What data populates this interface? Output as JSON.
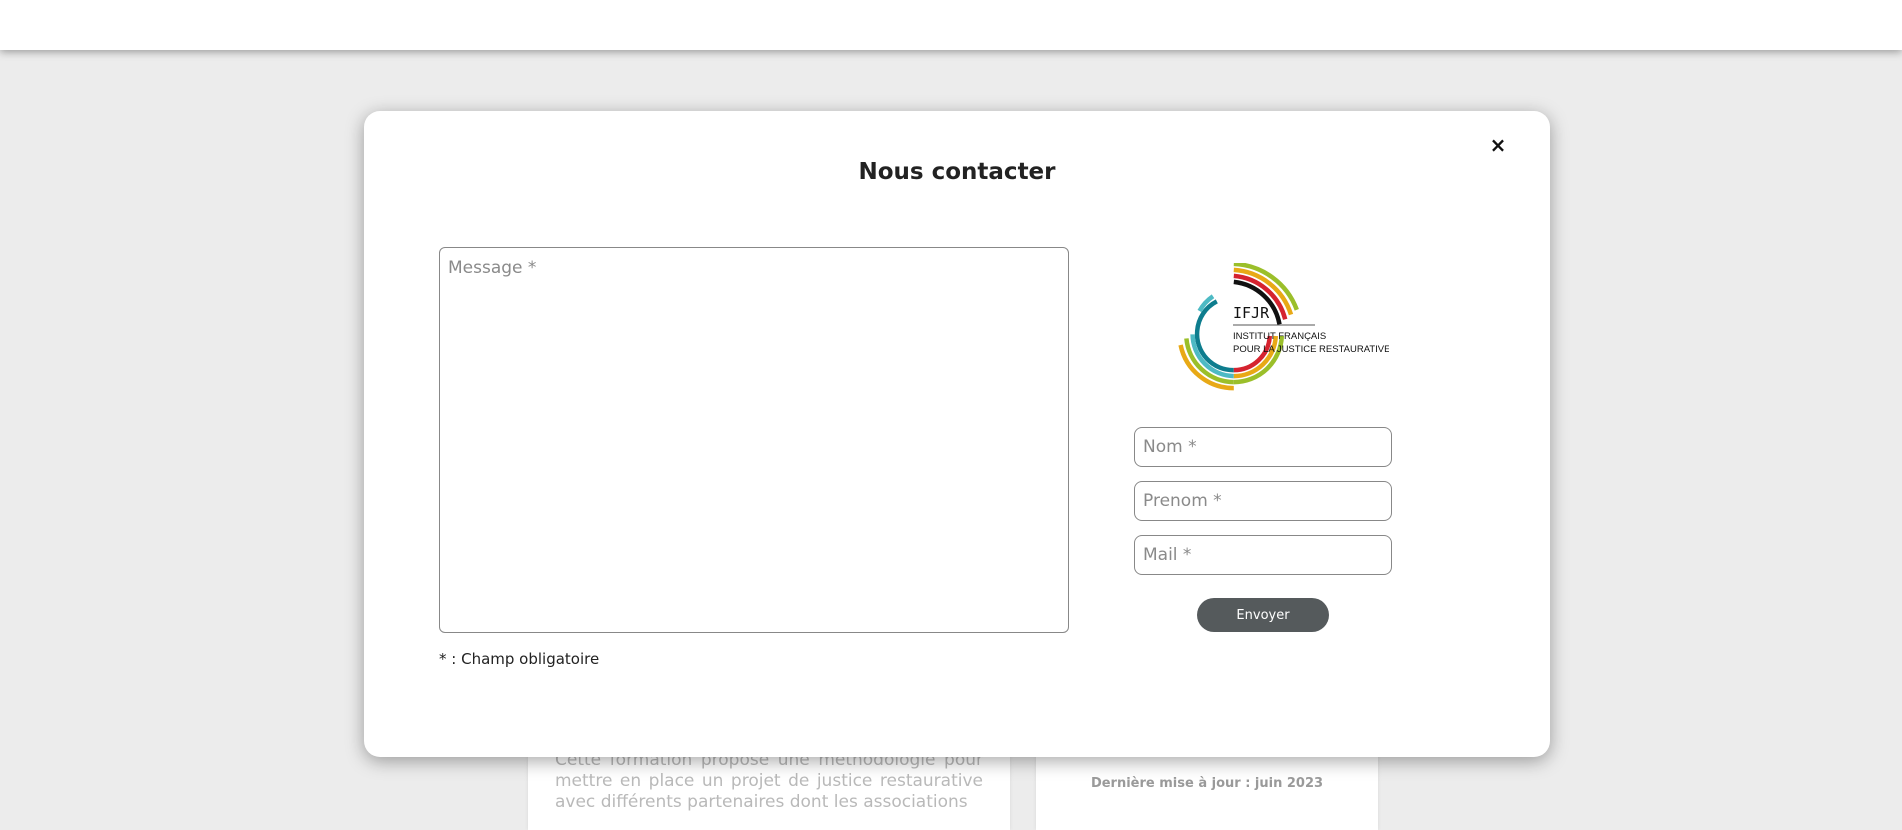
{
  "background": {
    "article_text": "Cette formation propose une méthodologie pour mettre en place un projet de justice restaurative avec différents partenaires dont les associations",
    "last_update": "Dernière mise à jour : juin 2023"
  },
  "modal": {
    "title": "Nous contacter",
    "close_icon": "×",
    "message_placeholder": "Message *",
    "required_note": "* : Champ obligatoire",
    "logo": {
      "acronym": "IFJR",
      "line1": "INSTITUT FRANÇAIS",
      "line2": "POUR LA JUSTICE RESTAURATIVE",
      "arc_colors": [
        "#111111",
        "#d5232f",
        "#e8a916",
        "#9bbf2a",
        "#0e7d8e",
        "#4dbac4"
      ]
    },
    "fields": {
      "nom_placeholder": "Nom *",
      "prenom_placeholder": "Prenom *",
      "mail_placeholder": "Mail *"
    },
    "send_label": "Envoyer"
  }
}
